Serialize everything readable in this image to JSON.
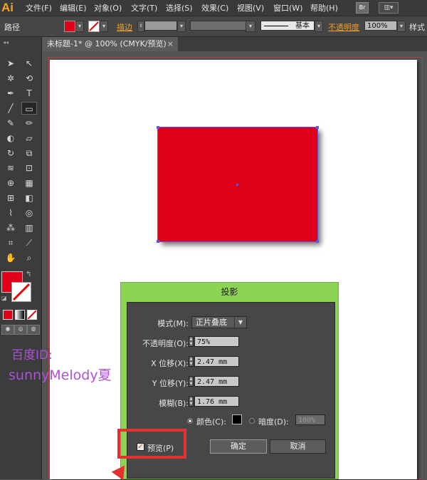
{
  "app": {
    "logo_text": "Ai",
    "menus": [
      "文件(F)",
      "编辑(E)",
      "对象(O)",
      "文字(T)",
      "选择(S)",
      "效果(C)",
      "视图(V)",
      "窗口(W)",
      "帮助(H)"
    ],
    "bridge_label": "Br"
  },
  "control_bar": {
    "selection_label": "路径",
    "stroke_label": "描边",
    "style_label": "基本",
    "opacity_label": "不透明度",
    "opacity_value": "100%",
    "style_tail_label": "样式",
    "fill_color": "#e1001a"
  },
  "document": {
    "tab_title": "未标题-1* @ 100% (CMYK/预览)",
    "close_glyph": "×"
  },
  "artwork": {
    "shape_fill": "#e1001a",
    "selection_color": "#5a5ae0"
  },
  "dialog": {
    "title": "投影",
    "mode_label": "模式(M):",
    "mode_value": "正片叠底",
    "opacity_label": "不透明度(O):",
    "opacity_value": "75%",
    "x_offset_label": "X 位移(X):",
    "x_offset_value": "2.47 mm",
    "y_offset_label": "Y 位移(Y):",
    "y_offset_value": "2.47 mm",
    "blur_label": "模糊(B):",
    "blur_value": "1.76 mm",
    "color_label": "颜色(C):",
    "darkness_label": "暗度(D):",
    "darkness_value": "100%",
    "preview_label": "预览(P)",
    "preview_checked": true,
    "ok_label": "确定",
    "cancel_label": "取消",
    "header_color": "#8ed454"
  },
  "watermark": {
    "line1": "百度ID:",
    "line2": "sunnyMelody夏"
  },
  "annotation_color": "#e53030"
}
